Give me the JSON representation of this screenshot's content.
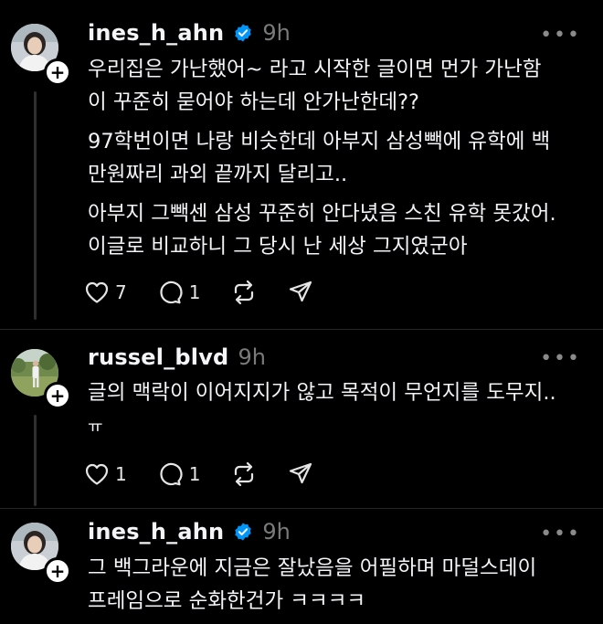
{
  "posts": [
    {
      "username": "ines_h_ahn",
      "verified": true,
      "time": "9h",
      "lines": [
        "우리집은 가난했어~ 라고 시작한 글이면 먼가 가난함",
        "이 꾸준히 묻어야 하는데 안가난한데??",
        "97학번이면 나랑 비슷한데 아부지 삼성빽에 유학에 백",
        "만원짜리 과외 끝까지 달리고..",
        "아부지 그빽센 삼성 꾸준히 안다녔음 스친 유학 못갔어.",
        "이글로 비교하니 그 당시 난 세상 그지였군아"
      ],
      "likes": "7",
      "replies": "1"
    },
    {
      "username": "russel_blvd",
      "verified": false,
      "time": "9h",
      "lines": [
        "글의 맥락이 이어지지가 않고 목적이 무언지를 도무지..",
        "ㅠ"
      ],
      "likes": "1",
      "replies": "1"
    },
    {
      "username": "ines_h_ahn",
      "verified": true,
      "time": "9h",
      "lines": [
        "그 백그라운에 지금은 잘났음을 어필하며 마덜스데이",
        "프레임으로 순화한건가 ㅋㅋㅋㅋ"
      ]
    }
  ],
  "more_icon": "ellipsis-icon",
  "colors": {
    "background": "#000000",
    "text": "#f3f5f7",
    "muted": "#7a7a7a",
    "verified": "#0095f6"
  }
}
